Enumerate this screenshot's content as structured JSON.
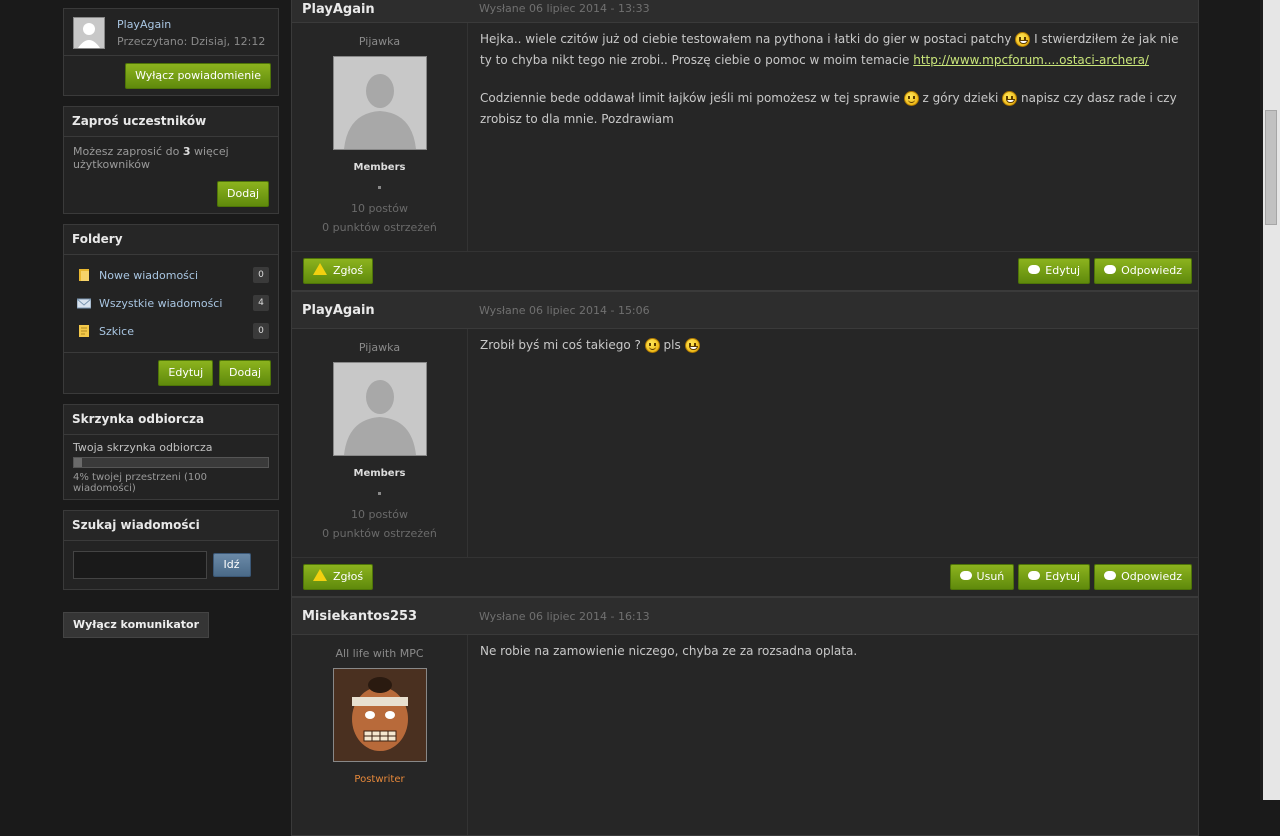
{
  "notify_box": {
    "user": "PlayAgain",
    "read": "Przeczytano: Dzisiaj, 12:12",
    "button": "Wyłącz powiadomienie"
  },
  "invite": {
    "title": "Zaproś uczestników",
    "text_before": "Możesz zaprosić do ",
    "count": "3",
    "text_after": " więcej użytkowników",
    "button": "Dodaj"
  },
  "folders": {
    "title": "Foldery",
    "items": [
      {
        "label": "Nowe wiadomości",
        "count": "0",
        "icon": "folder-new-icon"
      },
      {
        "label": "Wszystkie wiadomości",
        "count": "4",
        "icon": "envelope-icon"
      },
      {
        "label": "Szkice",
        "count": "0",
        "icon": "draft-icon"
      }
    ],
    "edit_button": "Edytuj",
    "add_button": "Dodaj"
  },
  "inbox": {
    "title": "Skrzynka odbiorcza",
    "label": "Twoja skrzynka odbiorcza",
    "usage": "4% twojej przestrzeni (100 wiadomości)",
    "usage_fraction": 0.04
  },
  "search": {
    "title": "Szukaj wiadomości",
    "value": "",
    "button": "Idź"
  },
  "messenger_button": "Wyłącz komunikator",
  "posts": [
    {
      "author": "PlayAgain",
      "date": "Wysłane 06 lipiec 2014 - 13:33",
      "user_title": "Pijawka",
      "group": "Members",
      "posts_count": "10 postów",
      "warnings": "0 punktów ostrzeżeń",
      "p1_a": "Hejka.. wiele czitów już od ciebie testowałem na pythona i łatki do gier w postaci patchy ",
      "p1_b": " I stwierdziłem że jak nie ty to chyba nikt tego nie zrobi.. Proszę ciebie o pomoc w moim temacie ",
      "p1_link": "http://www.mpcforum....ostaci-archera/",
      "p2_a": "Codziennie bede oddawał limit łajków jeśli mi pomożesz w tej sprawie ",
      "p2_b": " z góry dzieki ",
      "p2_c": " napisz czy dasz rade i czy zrobisz to dla mnie. Pozdrawiam",
      "report": "Zgłoś",
      "edit": "Edytuj",
      "reply": "Odpowiedz"
    },
    {
      "author": "PlayAgain",
      "date": "Wysłane 06 lipiec 2014 - 15:06",
      "user_title": "Pijawka",
      "group": "Members",
      "posts_count": "10 postów",
      "warnings": "0 punktów ostrzeżeń",
      "p1_a": "Zrobił byś mi coś takiego ? ",
      "p1_b": "  pls ",
      "report": "Zgłoś",
      "delete": "Usuń",
      "edit": "Edytuj",
      "reply": "Odpowiedz"
    },
    {
      "author": "Misiekantos253",
      "date": "Wysłane 06 lipiec 2014 - 16:13",
      "user_title": "All life with MPC",
      "group": "Postwriter",
      "p1": "Ne robie na zamowienie niczego, chyba ze za rozsadna oplata."
    }
  ]
}
